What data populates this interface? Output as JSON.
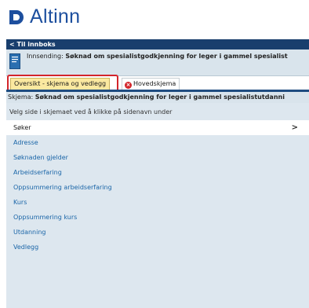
{
  "brand": {
    "name": "Altinn",
    "color": "#1d4f9e"
  },
  "nav": {
    "back_label": "< Til innboks"
  },
  "submission": {
    "prefix": "Innsending: ",
    "title": "Søknad om spesialistgodkjenning for leger i gammel spesialist"
  },
  "tabs": {
    "overview_label": "Oversikt - skjema og vedlegg",
    "main_label": "Hovedskjema",
    "error_icon": "error-icon"
  },
  "schema": {
    "prefix": "Skjema: ",
    "title": "Søknad om spesialistgodkjenning for leger i gammel spesialistutdanni"
  },
  "panel": {
    "instruction": "Velg side i skjemaet ved å klikke på sidenavn under",
    "items": [
      {
        "label": "Søker"
      },
      {
        "label": "Adresse"
      },
      {
        "label": "Søknaden gjelder"
      },
      {
        "label": "Arbeidserfaring"
      },
      {
        "label": "Oppsummering arbeidserfaring"
      },
      {
        "label": "Kurs"
      },
      {
        "label": "Oppsummering kurs"
      },
      {
        "label": "Utdanning"
      },
      {
        "label": "Vedlegg"
      }
    ],
    "active_chevron": ">"
  },
  "colors": {
    "nav_bar": "#193e6d",
    "highlight": "#d3252b",
    "panel_bg": "#dde7ef",
    "link": "#1b66a8"
  }
}
